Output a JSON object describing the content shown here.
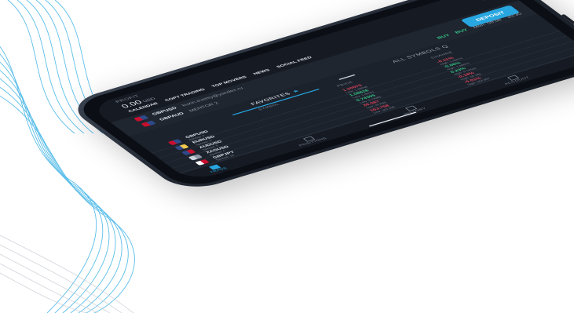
{
  "header": {
    "profit_label": "PROFIT",
    "profit_value": "0.00",
    "profit_currency": "USD"
  },
  "news_tabs": [
    "CALENDAR",
    "COPY TRADING",
    "TOP MOVERS",
    "NEWS",
    "SOCIAL FEED"
  ],
  "ticker": [
    {
      "symbol": "GBPUSD",
      "source": "kuzin.evetsy@yandex.ru"
    },
    {
      "symbol": "GBPAUD",
      "source": "MENTOR 2"
    }
  ],
  "deposit_label": "DEPOSIT",
  "buy_row": {
    "buy1": "BUY",
    "buy2": "BUY",
    "time1": "Mon. 08:06",
    "time2": "20:30"
  },
  "tabs": {
    "favorites": "FAVORITES",
    "star": "★",
    "all_symbols": "ALL SYMBOLS Q"
  },
  "columns": {
    "symbol": "SYMBOL",
    "price": "PRICE",
    "change": "CHANGE"
  },
  "rows": [
    {
      "symbol": "GBPUSD",
      "spread": "Spread: 4",
      "price": "1.30075",
      "low": "Low: 1.28940",
      "change": "-0.11%",
      "high": "High: 1.30374",
      "dir": "neg",
      "flag": [
        "#c8102e",
        "#2f4a8a"
      ]
    },
    {
      "symbol": "EURUSD",
      "spread": "Spread: 3",
      "price": "1.08826",
      "low": "Low: 1.08401",
      "change": "-0.06%",
      "high": "High: 1.09075",
      "dir": "pos",
      "flag": [
        "#2f4a8a",
        "#f2c94c"
      ]
    },
    {
      "symbol": "AUDUSD",
      "spread": "Spread: 5",
      "price": "0.74305",
      "low": "Low: 0.73986",
      "change": "0.23%",
      "high": "High: 0.74524",
      "dir": "pos",
      "flag": [
        "#2f4a8a",
        "#c8102e"
      ]
    },
    {
      "symbol": "XAGUSD",
      "spread": "Spread: 4",
      "price": "26.087",
      "low": "Low: 25.840",
      "change": "-0.18%",
      "high": "High: 26.380",
      "dir": "neg",
      "flag": [
        "#c9d1dc",
        "#8e97a5"
      ]
    },
    {
      "symbol": "GBPJPY",
      "spread": "Spread: 10",
      "price": "163.758",
      "low": "Low: 163.298",
      "change": "-0.01%",
      "high": "High: 164.097",
      "dir": "neg",
      "flag": [
        "#ffffff",
        "#c8102e"
      ]
    },
    {
      "symbol": "GER30",
      "spread": "Spread: 25",
      "price": "14068.3",
      "low": "Low: 13985.5",
      "change": "-0.03%",
      "high": "High: 14132.2",
      "dir": "pos",
      "flag": [
        "#222222",
        "#f2c94c"
      ]
    },
    {
      "symbol": "US500",
      "spread": "Spread: 5",
      "price": "4402.6",
      "low": "Low: 4385.8",
      "change": "-0.07%",
      "high": "High: 4412.8",
      "dir": "neg",
      "flag": [
        "#c8102e",
        "#2f4a8a"
      ]
    }
  ],
  "nav": [
    {
      "label": "TRADE",
      "active": true
    },
    {
      "label": "POSITIONS",
      "active": false
    },
    {
      "label": "HISTORY",
      "active": false
    },
    {
      "label": "ACCOUNT",
      "active": false
    }
  ]
}
